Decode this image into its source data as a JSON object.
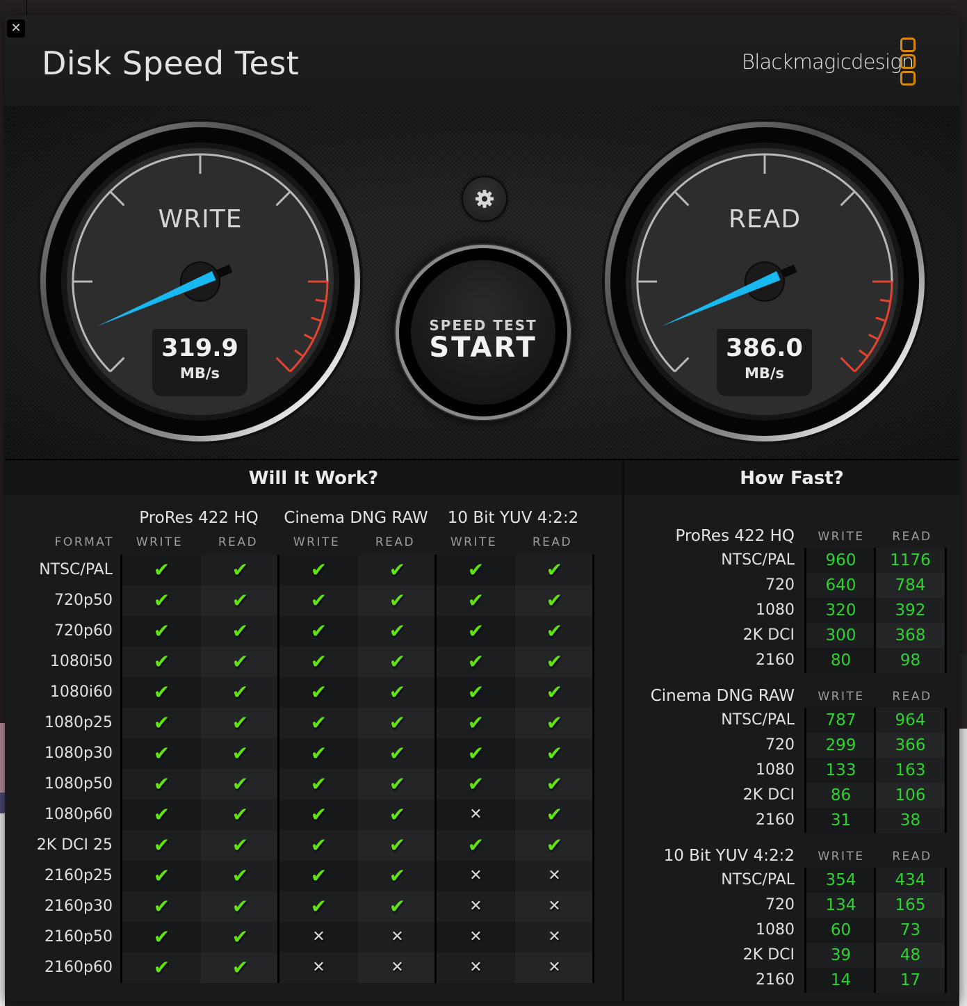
{
  "window": {
    "title": "Disk Speed Test",
    "brand": "Blackmagicdesign",
    "close_label": "✕",
    "brand_color": "#d4890f"
  },
  "gauges": {
    "write": {
      "label": "WRITE",
      "value": "319.9",
      "unit": "MB/s",
      "needle_fraction": 0.08
    },
    "read": {
      "label": "READ",
      "value": "386.0",
      "unit": "MB/s",
      "needle_fraction": 0.08
    }
  },
  "controls": {
    "settings_icon": "gear-icon",
    "start_small": "SPEED TEST",
    "start_big": "START"
  },
  "will_it_work": {
    "title": "Will It Work?",
    "format_header": "FORMAT",
    "codecs": [
      "ProRes 422 HQ",
      "Cinema DNG RAW",
      "10 Bit YUV 4:2:2"
    ],
    "subheaders": [
      "WRITE",
      "READ",
      "WRITE",
      "READ",
      "WRITE",
      "READ"
    ],
    "rows": [
      {
        "format": "NTSC/PAL",
        "results": [
          true,
          true,
          true,
          true,
          true,
          true
        ]
      },
      {
        "format": "720p50",
        "results": [
          true,
          true,
          true,
          true,
          true,
          true
        ]
      },
      {
        "format": "720p60",
        "results": [
          true,
          true,
          true,
          true,
          true,
          true
        ]
      },
      {
        "format": "1080i50",
        "results": [
          true,
          true,
          true,
          true,
          true,
          true
        ]
      },
      {
        "format": "1080i60",
        "results": [
          true,
          true,
          true,
          true,
          true,
          true
        ]
      },
      {
        "format": "1080p25",
        "results": [
          true,
          true,
          true,
          true,
          true,
          true
        ]
      },
      {
        "format": "1080p30",
        "results": [
          true,
          true,
          true,
          true,
          true,
          true
        ]
      },
      {
        "format": "1080p50",
        "results": [
          true,
          true,
          true,
          true,
          true,
          true
        ]
      },
      {
        "format": "1080p60",
        "results": [
          true,
          true,
          true,
          true,
          false,
          true
        ]
      },
      {
        "format": "2K DCI 25",
        "results": [
          true,
          true,
          true,
          true,
          true,
          true
        ]
      },
      {
        "format": "2160p25",
        "results": [
          true,
          true,
          true,
          true,
          false,
          false
        ]
      },
      {
        "format": "2160p30",
        "results": [
          true,
          true,
          true,
          true,
          false,
          false
        ]
      },
      {
        "format": "2160p50",
        "results": [
          true,
          true,
          false,
          false,
          false,
          false
        ]
      },
      {
        "format": "2160p60",
        "results": [
          true,
          true,
          false,
          false,
          false,
          false
        ]
      }
    ],
    "check_glyph": "✔",
    "cross_glyph": "✕",
    "check_color": "#5fe40e"
  },
  "how_fast": {
    "title": "How Fast?",
    "value_color": "#2fd32f",
    "groups": [
      {
        "codec": "ProRes 422 HQ",
        "write_label": "WRITE",
        "read_label": "READ",
        "rows": [
          {
            "format": "NTSC/PAL",
            "write": "960",
            "read": "1176"
          },
          {
            "format": "720",
            "write": "640",
            "read": "784"
          },
          {
            "format": "1080",
            "write": "320",
            "read": "392"
          },
          {
            "format": "2K DCI",
            "write": "300",
            "read": "368"
          },
          {
            "format": "2160",
            "write": "80",
            "read": "98"
          }
        ]
      },
      {
        "codec": "Cinema DNG RAW",
        "write_label": "WRITE",
        "read_label": "READ",
        "rows": [
          {
            "format": "NTSC/PAL",
            "write": "787",
            "read": "964"
          },
          {
            "format": "720",
            "write": "299",
            "read": "366"
          },
          {
            "format": "1080",
            "write": "133",
            "read": "163"
          },
          {
            "format": "2K DCI",
            "write": "86",
            "read": "106"
          },
          {
            "format": "2160",
            "write": "31",
            "read": "38"
          }
        ]
      },
      {
        "codec": "10 Bit YUV 4:2:2",
        "write_label": "WRITE",
        "read_label": "READ",
        "rows": [
          {
            "format": "NTSC/PAL",
            "write": "354",
            "read": "434"
          },
          {
            "format": "720",
            "write": "134",
            "read": "165"
          },
          {
            "format": "1080",
            "write": "60",
            "read": "73"
          },
          {
            "format": "2K DCI",
            "write": "39",
            "read": "48"
          },
          {
            "format": "2160",
            "write": "14",
            "read": "17"
          }
        ]
      }
    ]
  }
}
